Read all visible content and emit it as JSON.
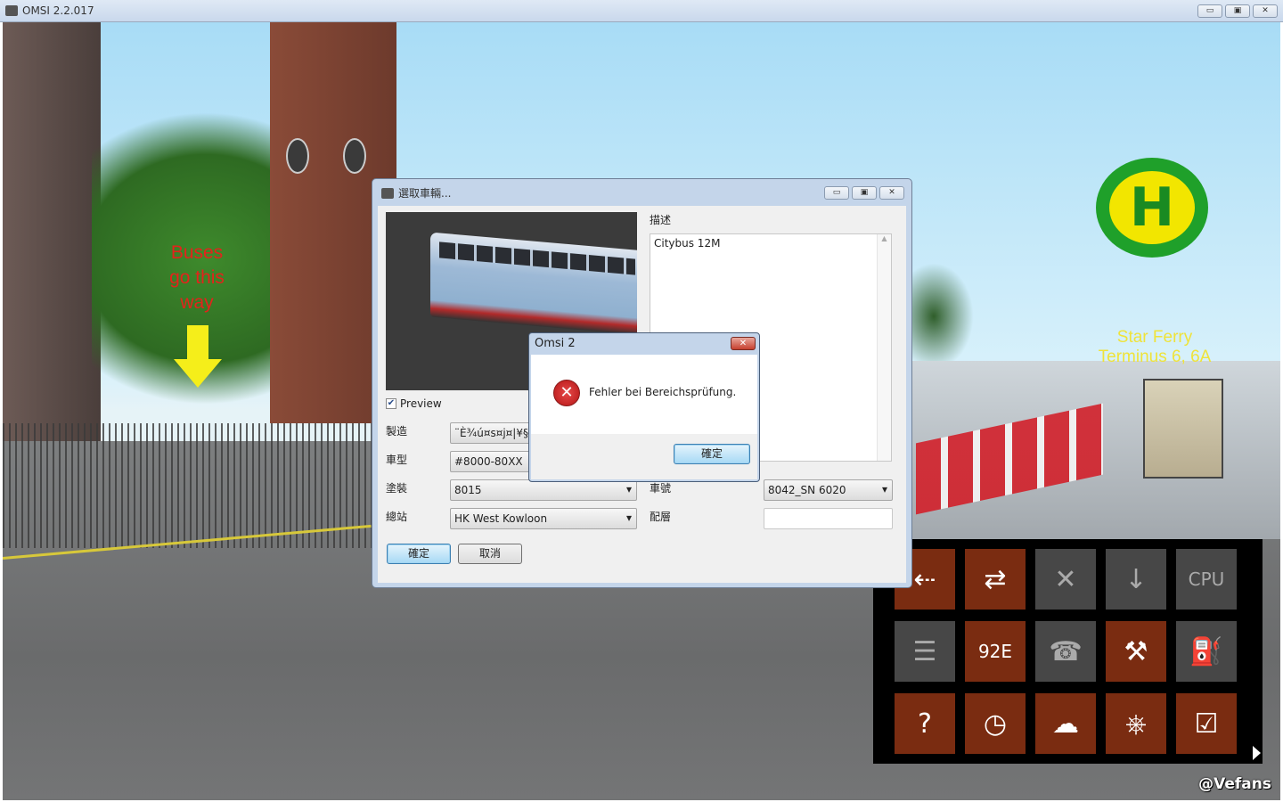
{
  "window": {
    "title": "OMSI 2.2.017",
    "controls": [
      "minimize",
      "maximize",
      "close"
    ]
  },
  "scene": {
    "sign_buses": "Buses go this way",
    "sign_terminus": "Star Ferry Terminus 6, 6A",
    "bus_stop_sign": "H",
    "watermark": "@Vefans"
  },
  "vehicle_dialog": {
    "title": "選取車輛...",
    "preview_label": "Preview",
    "preview_checked": true,
    "description_label": "描述",
    "description": "Citybus 12M",
    "fields": {
      "manufacturer": {
        "label": "製造",
        "value": "¨È¾ú¤s¤j¤|¥§¤"
      },
      "model": {
        "label": "車型",
        "value": "#8000-80XX"
      },
      "livery": {
        "label": "塗裝",
        "value": "8015"
      },
      "depot": {
        "label": "總站",
        "value": "HK West Kowloon"
      },
      "fleet_number": {
        "label": "車號",
        "value": "8042_SN 6020"
      },
      "equipment": {
        "label": "配層",
        "value": ""
      }
    },
    "ok_label": "確定",
    "cancel_label": "取消"
  },
  "error_dialog": {
    "title": "Omsi 2",
    "message": "Fehler bei Bereichsprüfung.",
    "ok_label": "確定"
  },
  "menu": {
    "tiles": [
      {
        "name": "bus-exit-icon",
        "glyph": "⇠",
        "active": true
      },
      {
        "name": "bus-switch-icon",
        "glyph": "⇄",
        "active": true
      },
      {
        "name": "bus-remove-icon",
        "glyph": "✕",
        "active": false
      },
      {
        "name": "bus-place-icon",
        "glyph": "↓",
        "active": false
      },
      {
        "name": "bus-ai-cpu-icon",
        "glyph": "CPU",
        "active": false
      },
      {
        "name": "timetable-icon",
        "glyph": "☰",
        "active": false
      },
      {
        "name": "route-number-icon",
        "glyph": "92E",
        "active": true
      },
      {
        "name": "tow-call-icon",
        "glyph": "☎",
        "active": false
      },
      {
        "name": "repair-tools-icon",
        "glyph": "⚒",
        "active": true
      },
      {
        "name": "refuel-icon",
        "glyph": "⛽",
        "active": false
      },
      {
        "name": "help-arrow-icon",
        "glyph": "?",
        "active": true
      },
      {
        "name": "clock-icon",
        "glyph": "◷",
        "active": true
      },
      {
        "name": "weather-icon",
        "glyph": "☁",
        "active": true
      },
      {
        "name": "controls-icon",
        "glyph": "⎈",
        "active": true
      },
      {
        "name": "checklist-icon",
        "glyph": "☑",
        "active": true
      }
    ]
  }
}
